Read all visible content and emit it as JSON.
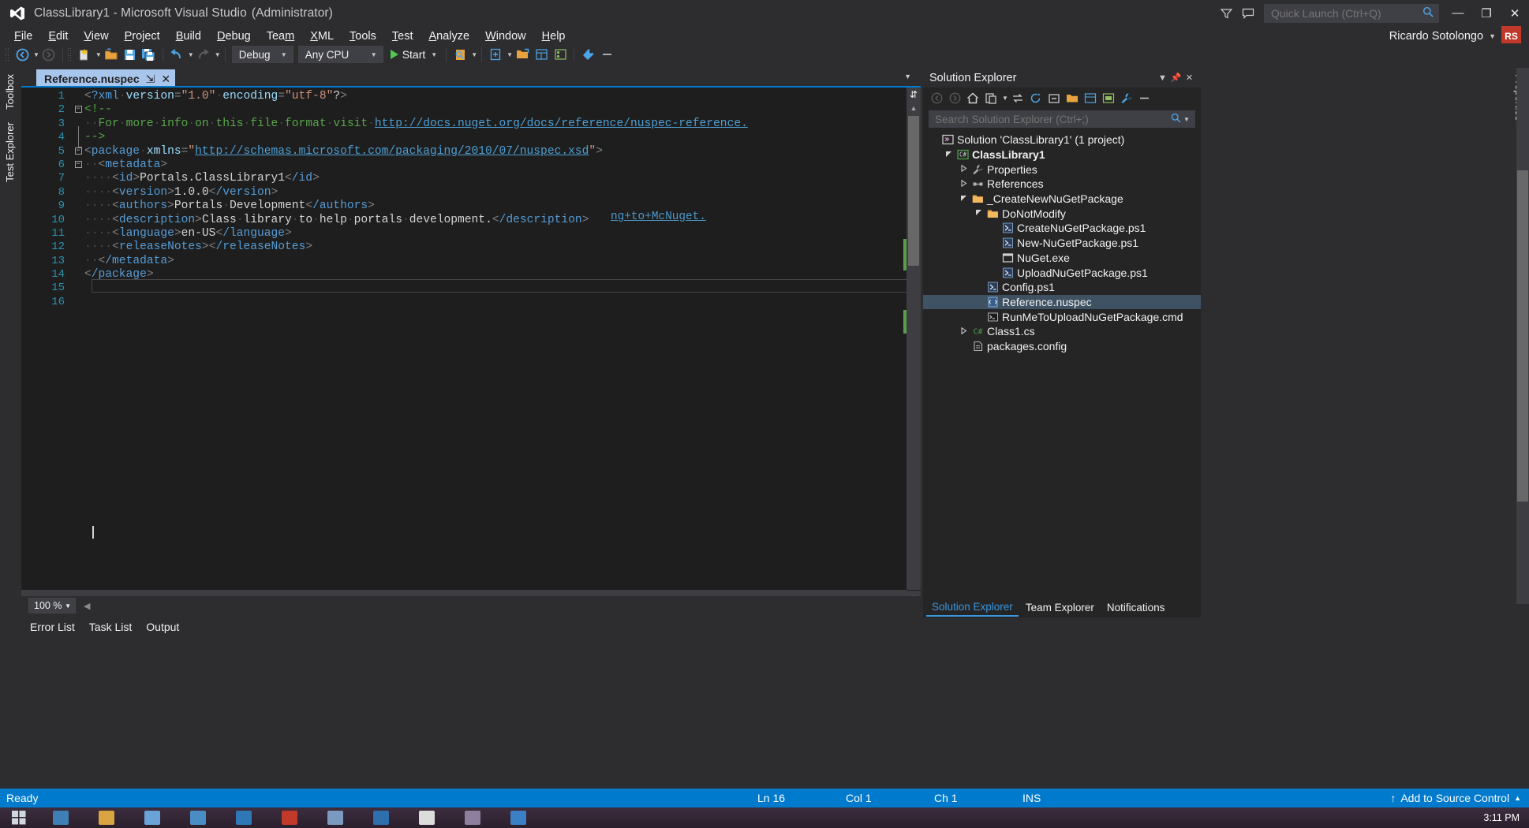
{
  "titlebar": {
    "title": "ClassLibrary1 - Microsoft Visual Studio",
    "admin": "(Administrator)",
    "quick_launch_placeholder": "Quick Launch (Ctrl+Q)",
    "minimize": "—",
    "maximize": "❐",
    "close": "✕"
  },
  "menubar": {
    "items": [
      {
        "label": "File",
        "accel": "F"
      },
      {
        "label": "Edit",
        "accel": "E"
      },
      {
        "label": "View",
        "accel": "V"
      },
      {
        "label": "Project",
        "accel": "P"
      },
      {
        "label": "Build",
        "accel": "B"
      },
      {
        "label": "Debug",
        "accel": "D"
      },
      {
        "label": "Team",
        "accel": "m"
      },
      {
        "label": "XML",
        "accel": "X"
      },
      {
        "label": "Tools",
        "accel": "T"
      },
      {
        "label": "Test",
        "accel": "T"
      },
      {
        "label": "Analyze",
        "accel": "A"
      },
      {
        "label": "Window",
        "accel": "W"
      },
      {
        "label": "Help",
        "accel": "H"
      }
    ],
    "user": "Ricardo Sotolongo",
    "avatar_initials": "RS"
  },
  "toolbar": {
    "config": "Debug",
    "platform": "Any CPU",
    "start": "Start"
  },
  "left_rail": {
    "toolbox": "Toolbox",
    "test_explorer": "Test Explorer"
  },
  "right_rail": {
    "properties": "Properties"
  },
  "editor": {
    "tab_label": "Reference.nuspec",
    "pin_glyph": "⇲",
    "close_glyph": "✕",
    "ghost_text": "ng+to+McNuget.",
    "lines": [
      {
        "n": "1",
        "fold": "none"
      },
      {
        "n": "2",
        "fold": "minus"
      },
      {
        "n": "3",
        "fold": "bar"
      },
      {
        "n": "4",
        "fold": "end"
      },
      {
        "n": "5",
        "fold": "minus"
      },
      {
        "n": "6",
        "fold": "minus"
      },
      {
        "n": "7",
        "fold": "none"
      },
      {
        "n": "8",
        "fold": "none"
      },
      {
        "n": "9",
        "fold": "none"
      },
      {
        "n": "10",
        "fold": "none"
      },
      {
        "n": "11",
        "fold": "none"
      },
      {
        "n": "12",
        "fold": "none"
      },
      {
        "n": "13",
        "fold": "none"
      },
      {
        "n": "14",
        "fold": "none"
      },
      {
        "n": "15",
        "fold": "none"
      },
      {
        "n": "16",
        "fold": "none"
      }
    ],
    "code_text": [
      "<?xml version=\"1.0\" encoding=\"utf-8\"?>",
      "<!--",
      "  For more info on this file format visit http://docs.nuget.org/docs/reference/nuspec-reference.",
      "-->",
      "<package xmlns=\"http://schemas.microsoft.com/packaging/2010/07/nuspec.xsd\">",
      "  <metadata>",
      "    <id>Portals.ClassLibrary1</id>",
      "    <version>1.0.0</version>",
      "    <authors>Portals Development</authors>",
      "    <description>Class library to help portals development.</description>",
      "    <language>en-US</language>",
      "    <releaseNotes></releaseNotes>",
      "  </metadata>",
      "</package>",
      "",
      ""
    ]
  },
  "zoombar": {
    "zoom": "100 %"
  },
  "bottom_tabs": [
    {
      "label": "Error List"
    },
    {
      "label": "Task List"
    },
    {
      "label": "Output"
    }
  ],
  "solution_explorer": {
    "title": "Solution Explorer",
    "search_placeholder": "Search Solution Explorer (Ctrl+;)",
    "tree": [
      {
        "label": "Solution 'ClassLibrary1' (1 project)",
        "indent": 0,
        "expander": "none",
        "icon": "solution-icon",
        "bold": false,
        "selected": false
      },
      {
        "label": "ClassLibrary1",
        "indent": 1,
        "expander": "expanded",
        "icon": "csharp-project-icon",
        "bold": true,
        "selected": false
      },
      {
        "label": "Properties",
        "indent": 2,
        "expander": "collapsed",
        "icon": "wrench-icon",
        "bold": false,
        "selected": false
      },
      {
        "label": "References",
        "indent": 2,
        "expander": "collapsed",
        "icon": "references-icon",
        "bold": false,
        "selected": false
      },
      {
        "label": "_CreateNewNuGetPackage",
        "indent": 2,
        "expander": "expanded",
        "icon": "folder-icon",
        "bold": false,
        "selected": false
      },
      {
        "label": "DoNotModify",
        "indent": 3,
        "expander": "expanded",
        "icon": "folder-icon",
        "bold": false,
        "selected": false
      },
      {
        "label": "CreateNuGetPackage.ps1",
        "indent": 4,
        "expander": "none",
        "icon": "ps1-icon",
        "bold": false,
        "selected": false
      },
      {
        "label": "New-NuGetPackage.ps1",
        "indent": 4,
        "expander": "none",
        "icon": "ps1-icon",
        "bold": false,
        "selected": false
      },
      {
        "label": "NuGet.exe",
        "indent": 4,
        "expander": "none",
        "icon": "exe-icon",
        "bold": false,
        "selected": false
      },
      {
        "label": "UploadNuGetPackage.ps1",
        "indent": 4,
        "expander": "none",
        "icon": "ps1-icon",
        "bold": false,
        "selected": false
      },
      {
        "label": "Config.ps1",
        "indent": 3,
        "expander": "none",
        "icon": "ps1-icon",
        "bold": false,
        "selected": false
      },
      {
        "label": "Reference.nuspec",
        "indent": 3,
        "expander": "none",
        "icon": "nuspec-icon",
        "bold": false,
        "selected": true
      },
      {
        "label": "RunMeToUploadNuGetPackage.cmd",
        "indent": 3,
        "expander": "none",
        "icon": "cmd-icon",
        "bold": false,
        "selected": false
      },
      {
        "label": "Class1.cs",
        "indent": 2,
        "expander": "collapsed",
        "icon": "cs-icon",
        "bold": false,
        "selected": false
      },
      {
        "label": "packages.config",
        "indent": 2,
        "expander": "none",
        "icon": "config-icon",
        "bold": false,
        "selected": false
      }
    ],
    "bottom_tabs": [
      {
        "label": "Solution Explorer",
        "active": true
      },
      {
        "label": "Team Explorer",
        "active": false
      },
      {
        "label": "Notifications",
        "active": false
      }
    ]
  },
  "statusbar": {
    "ready": "Ready",
    "ln": "Ln 16",
    "col": "Col 1",
    "ch": "Ch 1",
    "ins": "INS",
    "source_control": "Add to Source Control",
    "up_arrow": "↑",
    "caret": "▲"
  },
  "taskbar": {
    "clock": "3:11 PM"
  },
  "colors": {
    "accent": "#007acc",
    "title_bg": "#2d2d30",
    "editor_bg": "#1e1e1e",
    "panel_bg": "#252526",
    "selection": "#3f5263",
    "tab_active": "#a8c6ec",
    "comment": "#57a64a",
    "tag": "#569cd6",
    "string": "#ce9178",
    "link": "#4e9fd4",
    "linenum": "#2b91af"
  }
}
